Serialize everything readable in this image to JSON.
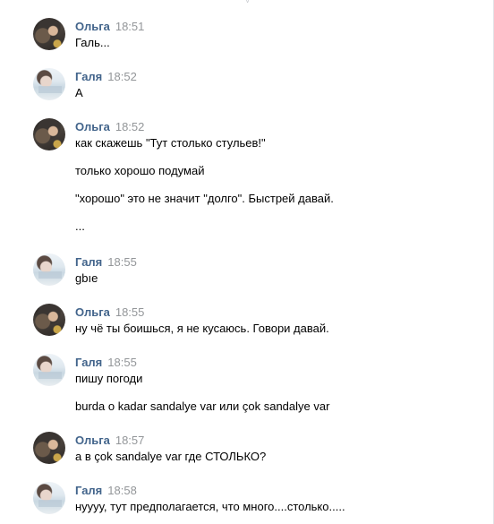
{
  "messages": [
    {
      "author": "Ольга",
      "avatar": "olga",
      "time": "18:51",
      "lines": [
        "Галь..."
      ]
    },
    {
      "author": "Галя",
      "avatar": "galya",
      "time": "18:52",
      "lines": [
        "А"
      ]
    },
    {
      "author": "Ольга",
      "avatar": "olga",
      "time": "18:52",
      "lines": [
        "как скажешь \"Тут столько стульев!\"",
        "только хорошо подумай",
        "\"хорошо\" это не значит \"долго\". Быстрей давай.",
        "..."
      ]
    },
    {
      "author": "Галя",
      "avatar": "galya",
      "time": "18:55",
      "lines": [
        "gbıe"
      ]
    },
    {
      "author": "Ольга",
      "avatar": "olga",
      "time": "18:55",
      "lines": [
        "ну чё ты боишься, я не кусаюсь. Говори давай."
      ]
    },
    {
      "author": "Галя",
      "avatar": "galya",
      "time": "18:55",
      "lines": [
        "пишу погоди",
        "burda o kadar sandalye var или çok sandalye var"
      ]
    },
    {
      "author": "Ольга",
      "avatar": "olga",
      "time": "18:57",
      "lines": [
        "а в çok sandalye var где СТОЛЬКО?"
      ]
    },
    {
      "author": "Галя",
      "avatar": "galya",
      "time": "18:58",
      "lines": [
        "нуууу, тут предполагается, что много....столько....."
      ]
    }
  ]
}
